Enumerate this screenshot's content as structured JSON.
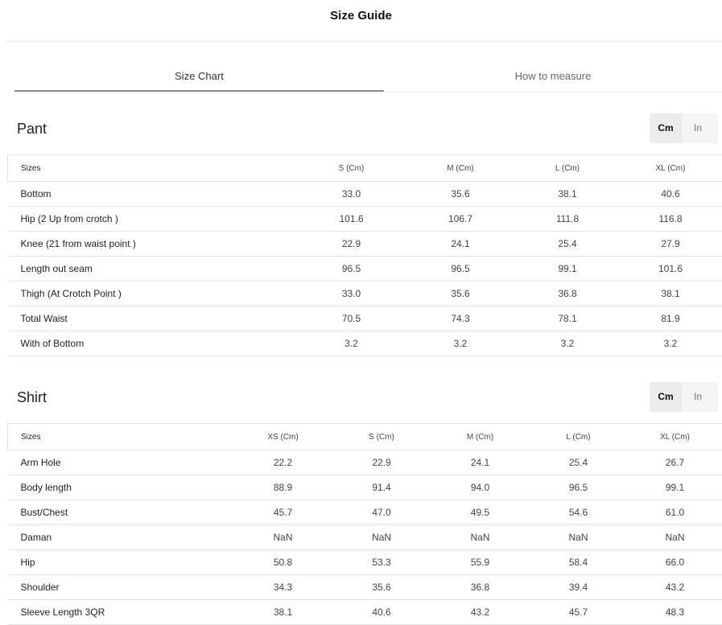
{
  "header": {
    "title": "Size Guide"
  },
  "tabs": [
    {
      "label": "Size Chart",
      "active": true
    },
    {
      "label": "How to measure",
      "active": false
    }
  ],
  "unit_toggle": {
    "cm_label": "Cm",
    "in_label": "In",
    "selected": "Cm"
  },
  "pant": {
    "title": "Pant",
    "columns": [
      "Sizes",
      "S (Cm)",
      "M (Cm)",
      "L (Cm)",
      "XL (Cm)"
    ],
    "rows": [
      [
        "Bottom",
        "33.0",
        "35.6",
        "38.1",
        "40.6"
      ],
      [
        "Hip (2 Up from crotch )",
        "101.6",
        "106.7",
        "111.8",
        "116.8"
      ],
      [
        "Knee (21 from waist point )",
        "22.9",
        "24.1",
        "25.4",
        "27.9"
      ],
      [
        "Length out seam",
        "96.5",
        "96.5",
        "99.1",
        "101.6"
      ],
      [
        "Thigh (At Crotch Point )",
        "33.0",
        "35.6",
        "36.8",
        "38.1"
      ],
      [
        "Total Waist",
        "70.5",
        "74.3",
        "78.1",
        "81.9"
      ],
      [
        "With of Bottom",
        "3.2",
        "3.2",
        "3.2",
        "3.2"
      ]
    ]
  },
  "shirt": {
    "title": "Shirt",
    "columns": [
      "Sizes",
      "XS (Cm)",
      "S (Cm)",
      "M (Cm)",
      "L (Cm)",
      "XL (Cm)"
    ],
    "rows": [
      [
        "Arm Hole",
        "22.2",
        "22.9",
        "24.1",
        "25.4",
        "26.7"
      ],
      [
        "Body length",
        "88.9",
        "91.4",
        "94.0",
        "96.5",
        "99.1"
      ],
      [
        "Bust/Chest",
        "45.7",
        "47.0",
        "49.5",
        "54.6",
        "61.0"
      ],
      [
        "Daman",
        "NaN",
        "NaN",
        "NaN",
        "NaN",
        "NaN"
      ],
      [
        "Hip",
        "50.8",
        "53.3",
        "55.9",
        "58.4",
        "66.0"
      ],
      [
        "Shoulder",
        "34.3",
        "35.6",
        "36.8",
        "39.4",
        "43.2"
      ],
      [
        "Sleeve Length 3QR",
        "38.1",
        "40.6",
        "43.2",
        "45.7",
        "48.3"
      ]
    ]
  }
}
